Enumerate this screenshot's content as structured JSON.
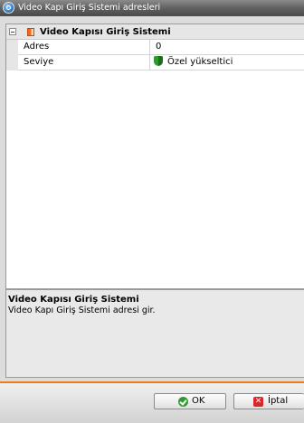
{
  "window": {
    "title": "Video Kapı Giriş Sistemi adresleri"
  },
  "section": {
    "label": "Video Kapısı Giriş Sistemi"
  },
  "properties": [
    {
      "name": "Adres",
      "value": "0"
    },
    {
      "name": "Seviye",
      "value": "Özel yükseltici",
      "icon": "shield-icon"
    }
  ],
  "description": {
    "title": "Video Kapısı Giriş Sistemi",
    "text": "Video Kapı Giriş Sistemi adresi gir."
  },
  "buttons": {
    "ok": "OK",
    "cancel": "İptal"
  },
  "colors": {
    "accent": "#f07a1a",
    "shield": "#2f9b2f",
    "cancel": "#d8262a"
  }
}
